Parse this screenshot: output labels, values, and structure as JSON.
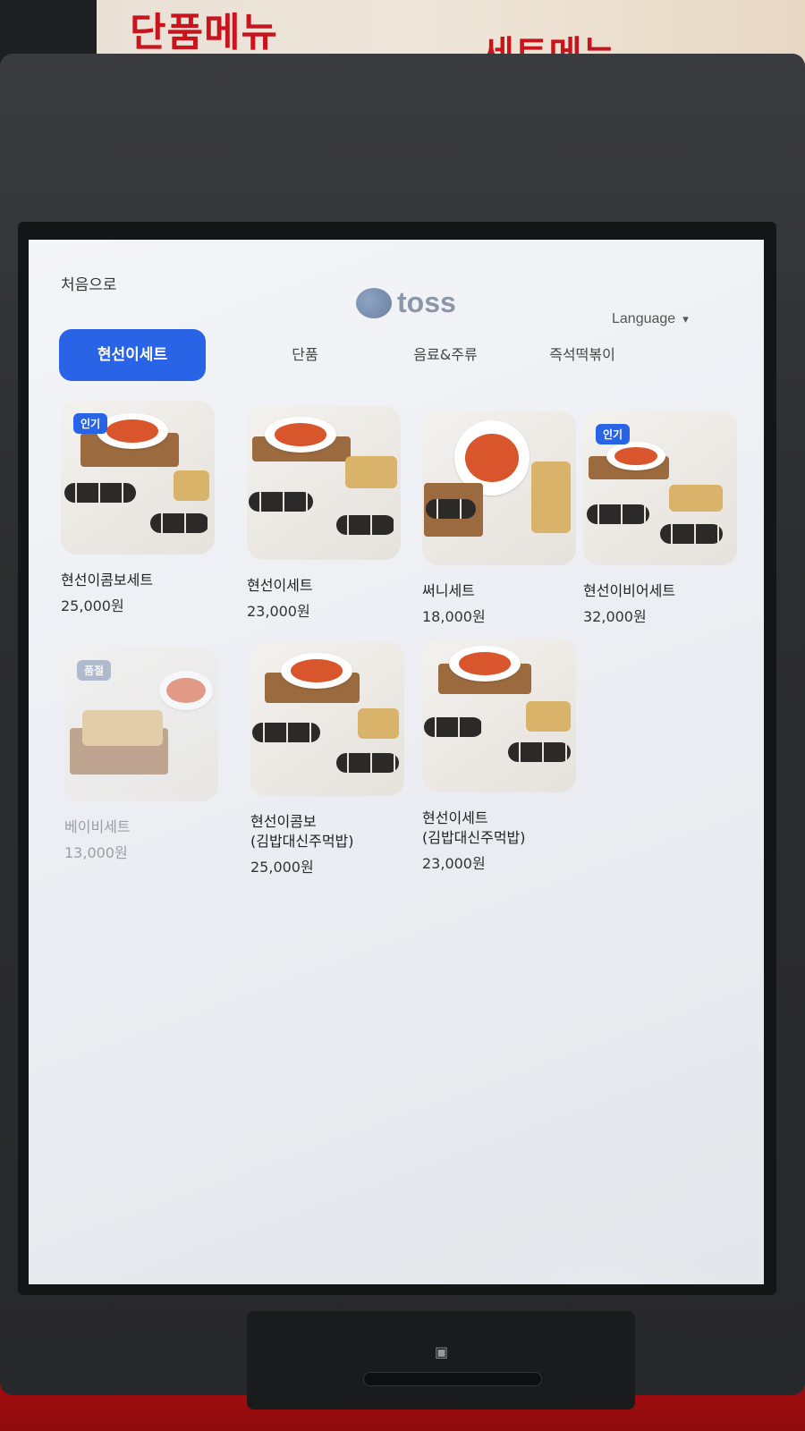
{
  "signage": {
    "left": "단품메뉴",
    "right": "세트메뉴"
  },
  "header": {
    "home_label": "처음으로",
    "brand_name": "toss",
    "language_label": "Language"
  },
  "tabs": [
    {
      "label": "현선이세트",
      "active": true
    },
    {
      "label": "단품",
      "active": false
    },
    {
      "label": "음료&주류",
      "active": false
    },
    {
      "label": "즉석떡볶이",
      "active": false
    }
  ],
  "items": [
    {
      "name": "현선이콤보세트",
      "price": "25,000원",
      "badge": "인기"
    },
    {
      "name": "현선이세트",
      "price": "23,000원",
      "badge": ""
    },
    {
      "name": "써니세트",
      "price": "18,000원",
      "badge": ""
    },
    {
      "name": "현선이비어세트",
      "price": "32,000원",
      "badge": "인기"
    },
    {
      "name": "베이비세트",
      "price": "13,000원",
      "badge": "품절"
    },
    {
      "name": "현선이콤보\n(김밥대신주먹밥)",
      "price": "25,000원",
      "badge": ""
    },
    {
      "name": "현선이세트\n(김밥대신주먹밥)",
      "price": "23,000원",
      "badge": ""
    }
  ],
  "colors": {
    "accent": "#2a64e6",
    "sign_red": "#c8141c"
  },
  "icons": {
    "language_toggle": "chevron-down-icon",
    "brand_logo": "toss-logo-icon"
  }
}
